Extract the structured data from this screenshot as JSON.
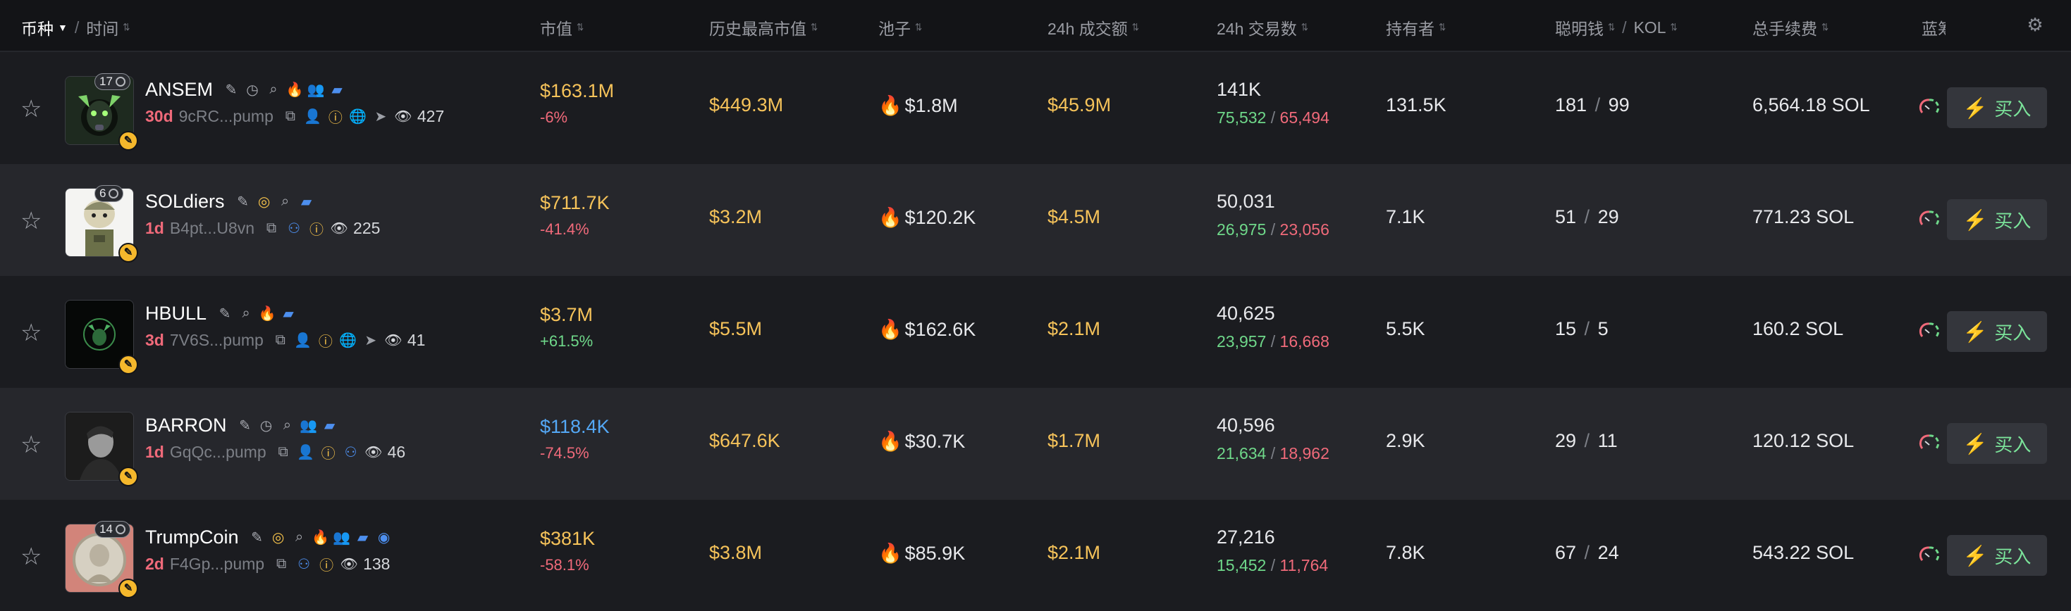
{
  "header": {
    "coin_label": "币种",
    "time_label": "时间",
    "market_cap": "市值",
    "ath_market_cap": "历史最高市值",
    "pool": "池子",
    "volume_24h": "24h 成交额",
    "tx_24h": "24h 交易数",
    "holders": "持有者",
    "smart_money": "聪明钱",
    "kol": "KOL",
    "total_fees": "总手续费",
    "bluechip": "蓝筹"
  },
  "buy_label": "买入",
  "colors": {
    "positive": "#6fd88a",
    "negative": "#f06a7a",
    "gold": "#f6c35a",
    "accent_blue": "#54a8f5"
  },
  "rows": [
    {
      "badge_count": "17",
      "name": "ANSEM",
      "age": "30d",
      "address": "9cRC...pump",
      "viewers": "427",
      "market_cap": "$163.1M",
      "change": "-6%",
      "ath": "$449.3M",
      "pool": "$1.8M",
      "volume": "$45.9M",
      "tx": "141K",
      "buys": "75,532",
      "sells": "65,494",
      "holders": "131.5K",
      "smart": "181",
      "kol": "99",
      "fees": "6,564.18 SOL"
    },
    {
      "badge_count": "6",
      "name": "SOLdiers",
      "age": "1d",
      "address": "B4pt...U8vn",
      "viewers": "225",
      "market_cap": "$711.7K",
      "change": "-41.4%",
      "ath": "$3.2M",
      "pool": "$120.2K",
      "volume": "$4.5M",
      "tx": "50,031",
      "buys": "26,975",
      "sells": "23,056",
      "holders": "7.1K",
      "smart": "51",
      "kol": "29",
      "fees": "771.23 SOL"
    },
    {
      "badge_count": "",
      "name": "HBULL",
      "age": "3d",
      "address": "7V6S...pump",
      "viewers": "41",
      "market_cap": "$3.7M",
      "change": "+61.5%",
      "ath": "$5.5M",
      "pool": "$162.6K",
      "volume": "$2.1M",
      "tx": "40,625",
      "buys": "23,957",
      "sells": "16,668",
      "holders": "5.5K",
      "smart": "15",
      "kol": "5",
      "fees": "160.2 SOL"
    },
    {
      "badge_count": "",
      "name": "BARRON",
      "age": "1d",
      "address": "GqQc...pump",
      "viewers": "46",
      "market_cap": "$118.4K",
      "change": "-74.5%",
      "ath": "$647.6K",
      "pool": "$30.7K",
      "volume": "$1.7M",
      "tx": "40,596",
      "buys": "21,634",
      "sells": "18,962",
      "holders": "2.9K",
      "smart": "29",
      "kol": "11",
      "fees": "120.12 SOL"
    },
    {
      "badge_count": "14",
      "name": "TrumpCoin",
      "age": "2d",
      "address": "F4Gp...pump",
      "viewers": "138",
      "market_cap": "$381K",
      "change": "-58.1%",
      "ath": "$3.8M",
      "pool": "$85.9K",
      "volume": "$2.1M",
      "tx": "27,216",
      "buys": "15,452",
      "sells": "11,764",
      "holders": "7.8K",
      "smart": "67",
      "kol": "24",
      "fees": "543.22 SOL"
    }
  ]
}
